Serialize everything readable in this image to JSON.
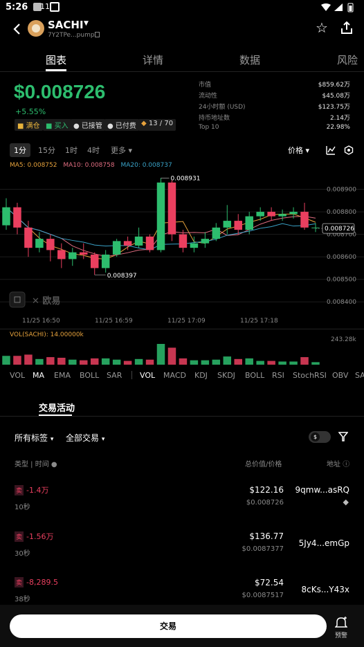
{
  "status": {
    "time": "5:26",
    "network": "11"
  },
  "header": {
    "token": "SACHI",
    "address": "7Y2TPe...pump"
  },
  "tabs": [
    {
      "label": "图表"
    },
    {
      "label": "详情"
    },
    {
      "label": "数据"
    },
    {
      "label": "风险"
    }
  ],
  "price": {
    "value": "$0.008726",
    "change": "+5.55%"
  },
  "badges": [
    {
      "label": "满仓"
    },
    {
      "label": "买入"
    },
    {
      "label": "已接管"
    },
    {
      "label": "已付费"
    },
    {
      "label": "13 / 70"
    }
  ],
  "stats": [
    {
      "k": "市值",
      "v": "$859.62万"
    },
    {
      "k": "流动性",
      "v": "$45.08万"
    },
    {
      "k": "24小时额 (USD)",
      "v": "$123.75万"
    },
    {
      "k": "持币地址数",
      "v": "2.14万"
    },
    {
      "k": "Top 10",
      "v": "22.98%"
    }
  ],
  "timeframes": [
    {
      "label": "1分"
    },
    {
      "label": "15分"
    },
    {
      "label": "1时"
    },
    {
      "label": "4时"
    },
    {
      "label": "更多"
    }
  ],
  "chart_tools": {
    "price_label": "价格"
  },
  "ma": {
    "ma5": "MA5: 0.008752",
    "ma10": "MA10: 0.008758",
    "ma20": "MA20: 0.008737"
  },
  "chart_data": {
    "type": "candlestick",
    "y_ticks": [
      "0.008900",
      "0.008800",
      "0.008700",
      "0.008600",
      "0.008500",
      "0.008400"
    ],
    "x_ticks": [
      "11/25 16:50",
      "11/25 16:59",
      "11/25 17:09",
      "11/25 17:18"
    ],
    "high_label": "0.008931",
    "low_label": "0.008397",
    "current_label": "0.008726",
    "ylim": [
      0.00837,
      0.00896
    ],
    "candles": [
      {
        "o": 0.00874,
        "c": 0.00882,
        "h": 0.00886,
        "l": 0.00872
      },
      {
        "o": 0.00882,
        "c": 0.00873,
        "h": 0.00884,
        "l": 0.0087
      },
      {
        "o": 0.00873,
        "c": 0.00864,
        "h": 0.00876,
        "l": 0.0086
      },
      {
        "o": 0.00864,
        "c": 0.00868,
        "h": 0.00871,
        "l": 0.00862
      },
      {
        "o": 0.00868,
        "c": 0.00863,
        "h": 0.0087,
        "l": 0.00858
      },
      {
        "o": 0.00863,
        "c": 0.00859,
        "h": 0.00866,
        "l": 0.00855
      },
      {
        "o": 0.00859,
        "c": 0.00862,
        "h": 0.00864,
        "l": 0.00856
      },
      {
        "o": 0.00862,
        "c": 0.00861,
        "h": 0.00866,
        "l": 0.00859
      },
      {
        "o": 0.00861,
        "c": 0.00855,
        "h": 0.00862,
        "l": 0.00852
      },
      {
        "o": 0.00855,
        "c": 0.00861,
        "h": 0.00863,
        "l": 0.00853
      },
      {
        "o": 0.00861,
        "c": 0.00867,
        "h": 0.00868,
        "l": 0.0086
      },
      {
        "o": 0.00867,
        "c": 0.00865,
        "h": 0.00869,
        "l": 0.00863
      },
      {
        "o": 0.00865,
        "c": 0.00869,
        "h": 0.00873,
        "l": 0.00864
      },
      {
        "o": 0.00869,
        "c": 0.00863,
        "h": 0.0087,
        "l": 0.00862
      },
      {
        "o": 0.00863,
        "c": 0.00893,
        "h": 0.00895,
        "l": 0.00862
      },
      {
        "o": 0.00893,
        "c": 0.0087,
        "h": 0.00894,
        "l": 0.00867
      },
      {
        "o": 0.0087,
        "c": 0.00864,
        "h": 0.00872,
        "l": 0.00862
      },
      {
        "o": 0.00864,
        "c": 0.00866,
        "h": 0.00869,
        "l": 0.00862
      },
      {
        "o": 0.00866,
        "c": 0.00868,
        "h": 0.00871,
        "l": 0.00864
      },
      {
        "o": 0.00868,
        "c": 0.00873,
        "h": 0.00875,
        "l": 0.00867
      },
      {
        "o": 0.00873,
        "c": 0.00876,
        "h": 0.00883,
        "l": 0.0087
      },
      {
        "o": 0.00876,
        "c": 0.00872,
        "h": 0.00879,
        "l": 0.0087
      },
      {
        "o": 0.00872,
        "c": 0.00878,
        "h": 0.0088,
        "l": 0.0087
      },
      {
        "o": 0.00878,
        "c": 0.0088,
        "h": 0.00882,
        "l": 0.00876
      },
      {
        "o": 0.0088,
        "c": 0.00878,
        "h": 0.00882,
        "l": 0.00876
      },
      {
        "o": 0.00878,
        "c": 0.00879,
        "h": 0.00881,
        "l": 0.00876
      },
      {
        "o": 0.00879,
        "c": 0.0088,
        "h": 0.00882,
        "l": 0.00877
      },
      {
        "o": 0.0088,
        "c": 0.00873,
        "h": 0.00884,
        "l": 0.00872
      },
      {
        "o": 0.00873,
        "c": 0.00873,
        "h": 0.00875,
        "l": 0.00871
      }
    ]
  },
  "volume": {
    "label": "VOL(SACHI): 14.00000k",
    "max_label": "243.28k"
  },
  "indicators": [
    {
      "label": "VOL"
    },
    {
      "label": "MA"
    },
    {
      "label": "EMA"
    },
    {
      "label": "BOLL"
    },
    {
      "label": "SAR"
    },
    {
      "label": "VOL"
    },
    {
      "label": "MACD"
    },
    {
      "label": "KDJ"
    },
    {
      "label": "SKDJ"
    },
    {
      "label": "BOLL"
    },
    {
      "label": "RSI"
    },
    {
      "label": "StochRSI"
    },
    {
      "label": "OBV"
    },
    {
      "label": "SA"
    }
  ],
  "activity": {
    "title": "交易活动",
    "filter_tags": "所有标签",
    "filter_trades": "全部交易",
    "col_type": "类型 | 时间",
    "col_value": "总价值/价格",
    "col_addr": "地址",
    "rows": [
      {
        "side": "卖",
        "amount": "-1.4万",
        "time": "10秒",
        "value": "$122.16",
        "price": "$0.008726",
        "addr": "9qmw...asRQ"
      },
      {
        "side": "卖",
        "amount": "-1.56万",
        "time": "30秒",
        "value": "$136.77",
        "price": "$0.0087377",
        "addr": "5Jy4...emGp"
      },
      {
        "side": "卖",
        "amount": "-8,289.5",
        "time": "38秒",
        "value": "$72.54",
        "price": "$0.0087517",
        "addr": "8cKs...Y43x"
      }
    ]
  },
  "bottom": {
    "trade": "交易",
    "alert": "预警"
  },
  "colors": {
    "up": "#2dbd6e",
    "down": "#ea3f5f",
    "ma5": "#e6a23c",
    "ma10": "#e06d80",
    "ma20": "#3aa3c8"
  }
}
